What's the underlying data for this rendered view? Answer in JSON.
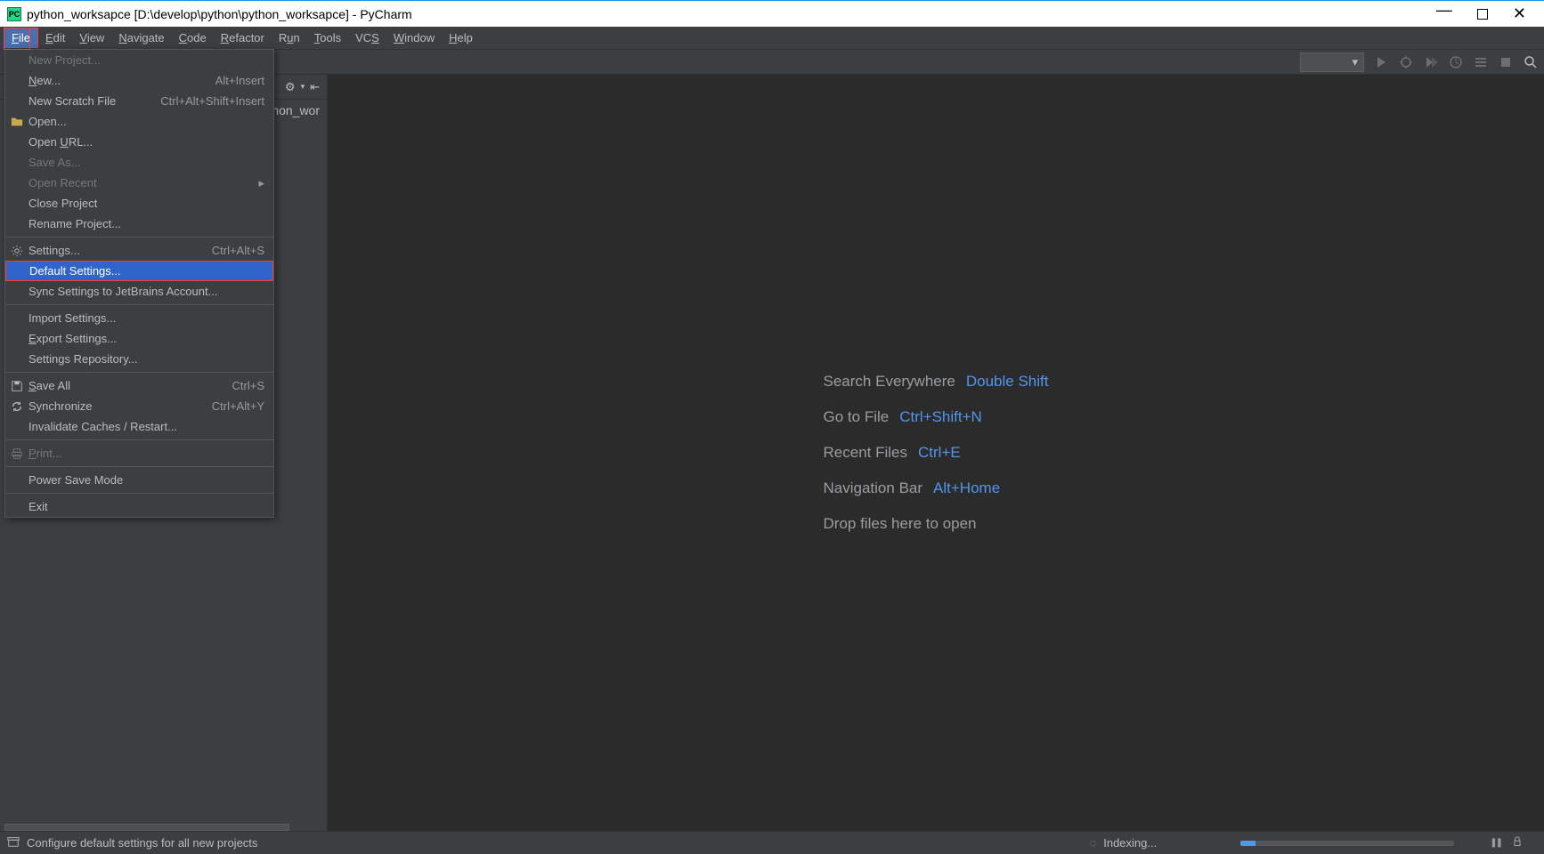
{
  "titlebar": {
    "icon_text": "PC",
    "text": "python_worksapce [D:\\develop\\python\\python_worksapce] - PyCharm"
  },
  "menubar": {
    "items": [
      {
        "label": "File",
        "mnemonic": "F",
        "active": true
      },
      {
        "label": "Edit",
        "mnemonic": "E"
      },
      {
        "label": "View",
        "mnemonic": "V"
      },
      {
        "label": "Navigate",
        "mnemonic": "N"
      },
      {
        "label": "Code",
        "mnemonic": "C"
      },
      {
        "label": "Refactor",
        "mnemonic": "R"
      },
      {
        "label": "Run",
        "mnemonic": "u",
        "pre": "R"
      },
      {
        "label": "Tools",
        "mnemonic": "T"
      },
      {
        "label": "VCS",
        "mnemonic": "S",
        "pre": "VC"
      },
      {
        "label": "Window",
        "mnemonic": "W"
      },
      {
        "label": "Help",
        "mnemonic": "H"
      }
    ]
  },
  "file_menu": {
    "items": [
      {
        "label": "New Project...",
        "disabled": true
      },
      {
        "label": "New...",
        "shortcut": "Alt+Insert",
        "mnemonic": "N"
      },
      {
        "label": "New Scratch File",
        "shortcut": "Ctrl+Alt+Shift+Insert"
      },
      {
        "label": "Open...",
        "icon": "folder"
      },
      {
        "label": "Open URL...",
        "mnemonic": "U",
        "pre": "Open "
      },
      {
        "label": "Save As...",
        "disabled": true
      },
      {
        "label": "Open Recent",
        "disabled": true,
        "submenu": true
      },
      {
        "label": "Close Project"
      },
      {
        "label": "Rename Project..."
      },
      {
        "sep": true
      },
      {
        "label": "Settings...",
        "shortcut": "Ctrl+Alt+S",
        "icon": "settings"
      },
      {
        "label": "Default Settings...",
        "selected": true
      },
      {
        "label": "Sync Settings to JetBrains Account..."
      },
      {
        "sep": true
      },
      {
        "label": "Import Settings..."
      },
      {
        "label": "Export Settings...",
        "mnemonic": "E"
      },
      {
        "label": "Settings Repository..."
      },
      {
        "sep": true
      },
      {
        "label": "Save All",
        "shortcut": "Ctrl+S",
        "icon": "save",
        "mnemonic": "S"
      },
      {
        "label": "Synchronize",
        "shortcut": "Ctrl+Alt+Y",
        "icon": "sync"
      },
      {
        "label": "Invalidate Caches / Restart..."
      },
      {
        "sep": true
      },
      {
        "label": "Print...",
        "disabled": true,
        "icon": "print",
        "mnemonic": "P"
      },
      {
        "sep": true
      },
      {
        "label": "Power Save Mode"
      },
      {
        "sep": true
      },
      {
        "label": "Exit"
      }
    ]
  },
  "project_tree": {
    "visible_text": "thon_wor"
  },
  "editor_hints": [
    {
      "text": "Search Everywhere",
      "shortcut": "Double Shift"
    },
    {
      "text": "Go to File",
      "shortcut": "Ctrl+Shift+N"
    },
    {
      "text": "Recent Files",
      "shortcut": "Ctrl+E"
    },
    {
      "text": "Navigation Bar",
      "shortcut": "Alt+Home"
    },
    {
      "text": "Drop files here to open",
      "shortcut": ""
    }
  ],
  "statusbar": {
    "left_text": "Configure default settings for all new projects",
    "indexing_text": "Indexing..."
  },
  "icons": {
    "dropdown": "▾",
    "gear": "⚙",
    "collapse": "⇤",
    "spinner": "◌",
    "pause": "❚❚",
    "trash": "🗑",
    "triangle_right": "▸"
  }
}
